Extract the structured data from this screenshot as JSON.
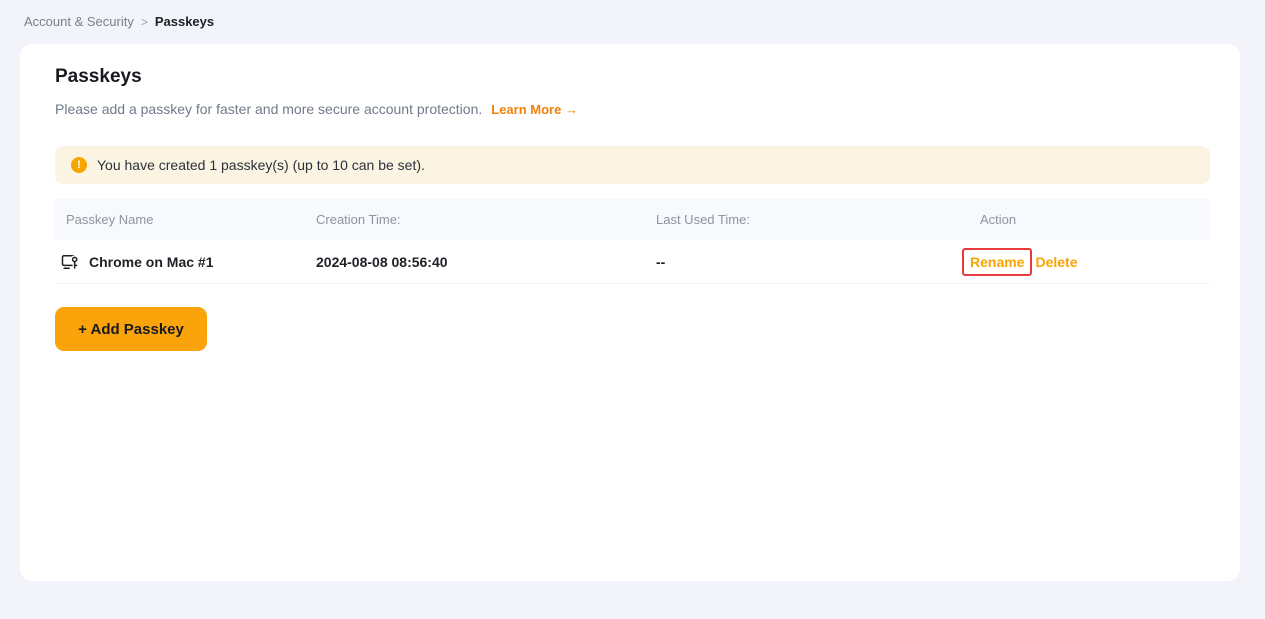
{
  "breadcrumb": {
    "parent": "Account & Security",
    "separator": ">",
    "current": "Passkeys"
  },
  "page": {
    "title": "Passkeys",
    "description": "Please add a passkey for faster and more secure account protection.",
    "learn_more_label": "Learn More",
    "learn_more_arrow": "→"
  },
  "banner": {
    "icon": "warning-icon",
    "icon_glyph": "!",
    "text": "You have created 1 passkey(s) (up to 10 can be set)."
  },
  "table": {
    "headers": [
      "Passkey Name",
      "Creation Time:",
      "Last Used Time:",
      "Action"
    ],
    "rows": [
      {
        "icon": "passkey-device-icon",
        "name": "Chrome on Mac #1",
        "creation_time": "2024-08-08 08:56:40",
        "last_used": "--",
        "rename_label": "Rename",
        "delete_label": "Delete"
      }
    ]
  },
  "buttons": {
    "add_passkey": "+ Add Passkey"
  },
  "colors": {
    "page_bg": "#F2F4F9",
    "card_bg": "#FFFFFF",
    "banner_bg": "#FBF4E2",
    "warning_icon": "#F7A600",
    "learn_more_link": "#EE8208",
    "action_link": "#F9A400",
    "add_button_bg": "#FBA30A",
    "annotation_red": "#E93B3B",
    "header_row_bg": "#F8F9FC"
  }
}
